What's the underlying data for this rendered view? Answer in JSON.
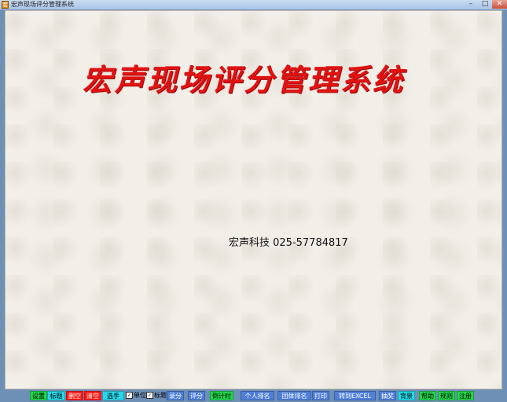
{
  "window": {
    "title": "宏声现场评分管理系统",
    "minimize": "–",
    "maximize": "□",
    "close": "✕"
  },
  "main": {
    "title": "宏声现场评分管理系统",
    "company": "宏声科技 025-57784817"
  },
  "toolbar": {
    "settings": "设置",
    "heading": "标题",
    "clear_col": "删空",
    "clear_all": "清空",
    "contestant": "选手",
    "unit_checkbox": "单位",
    "title_checkbox": "标题",
    "score_entry": "录分",
    "score": "评分",
    "countdown": "倒计时",
    "individual_rank": "个人排名",
    "team_rank": "团体排名",
    "print": "打印",
    "export_excel": "转到EXCEL",
    "lottery": "抽奖",
    "background": "背景",
    "help": "帮助",
    "rules": "规则",
    "register": "注册"
  }
}
